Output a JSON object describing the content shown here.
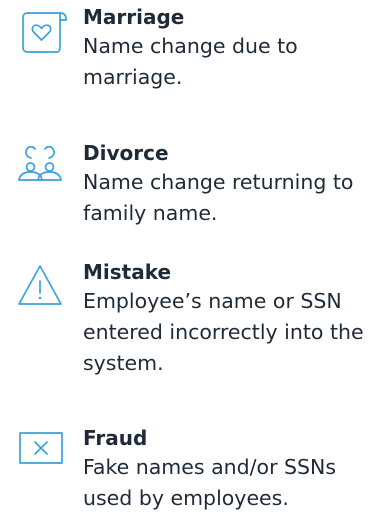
{
  "items": [
    {
      "icon": "marriage-certificate-icon",
      "title": "Marriage",
      "description": "Name change due to marriage."
    },
    {
      "icon": "divorce-people-icon",
      "title": "Divorce",
      "description": "Name change returning to family name."
    },
    {
      "icon": "warning-triangle-icon",
      "title": "Mistake",
      "description": "Employee’s name or SSN entered incorrectly into the system."
    },
    {
      "icon": "fraud-x-box-icon",
      "title": "Fraud",
      "description": "Fake names and/or SSNs used by employees."
    }
  ],
  "colors": {
    "icon_stroke": "#3ba1dc",
    "text": "#1f2a38"
  }
}
